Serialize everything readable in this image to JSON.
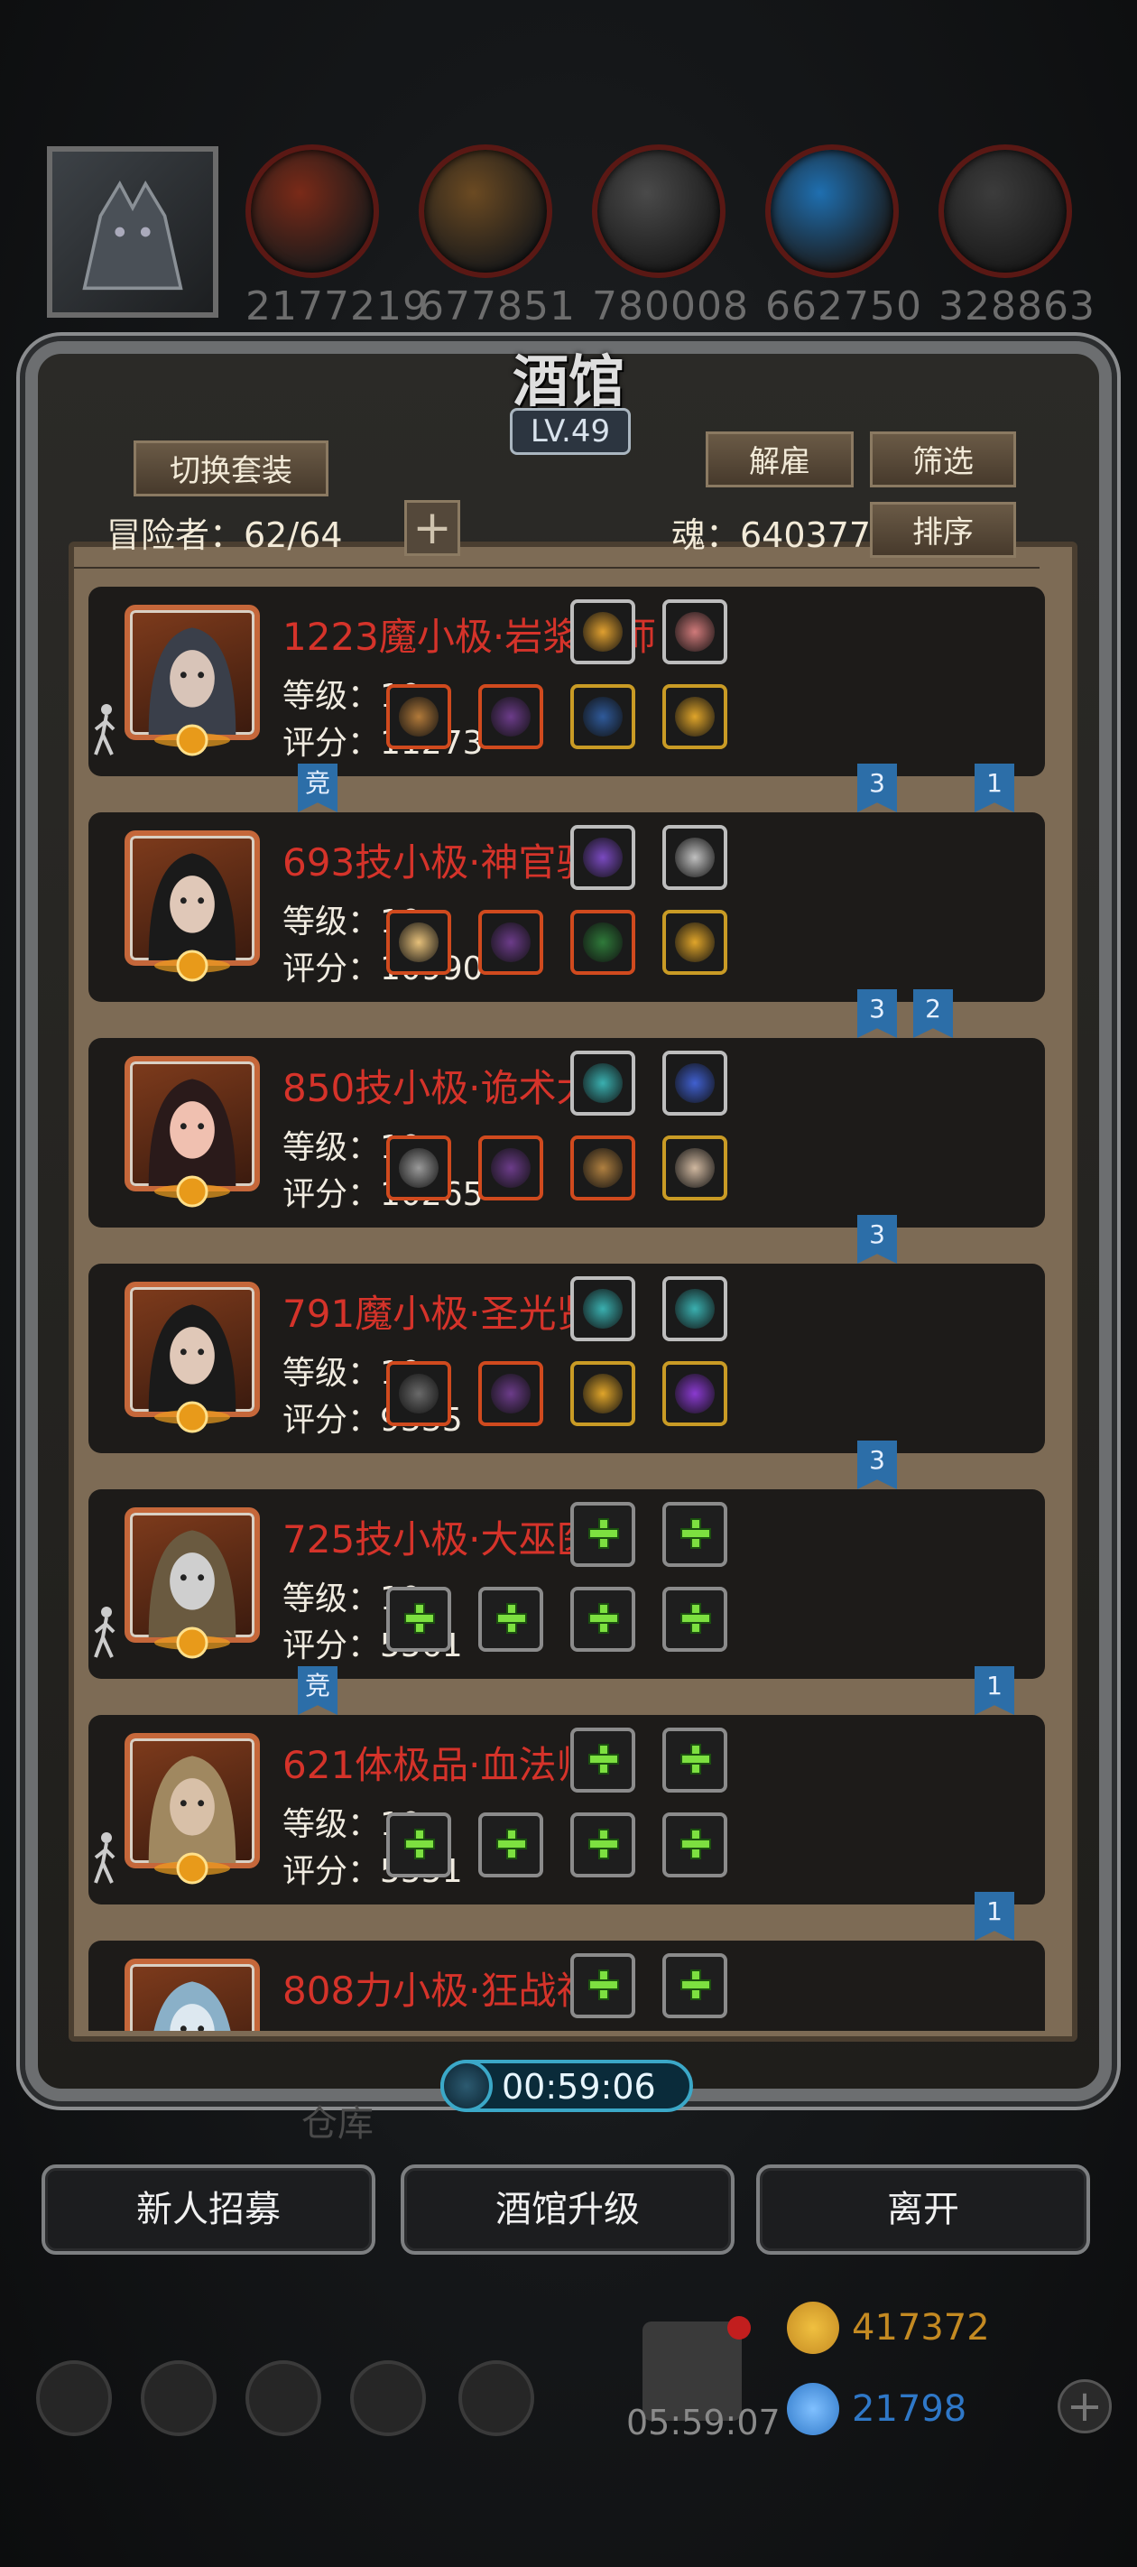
{
  "resources": [
    {
      "icon": "meat-icon",
      "value": "2177219",
      "color": "#7a2a18"
    },
    {
      "icon": "wood-icon",
      "value": "677851",
      "color": "#6b4a22"
    },
    {
      "icon": "iron-icon",
      "value": "780008",
      "color": "#4a4a4a"
    },
    {
      "icon": "crystal-icon",
      "value": "662750",
      "color": "#1f6fb0"
    },
    {
      "icon": "stone-icon",
      "value": "328863",
      "color": "#3c3c3c"
    }
  ],
  "panel": {
    "title": "酒馆",
    "level": "LV.49",
    "switch_outfit": "切换套装",
    "dismiss": "解雇",
    "filter": "筛选",
    "sort": "排序",
    "adventurers": "冒险者：62/64",
    "soul": "魂：640377"
  },
  "heroes": [
    {
      "name": "1223魔小极·岩浆法师",
      "level": "等级：10",
      "score": "评分：11273",
      "portrait": "hooded-mage",
      "equip": [
        "staff",
        "armor",
        "amulet",
        "ring"
      ],
      "top": [
        "lantern",
        "meat"
      ],
      "tags": [
        {
          "t": "竞",
          "pos": "left"
        },
        {
          "t": "3",
          "pos": "r1"
        },
        {
          "t": "1",
          "pos": "r2"
        }
      ]
    },
    {
      "name": "693技小极·神官骑士",
      "level": "等级：10",
      "score": "评分：10990",
      "portrait": "nun",
      "equip": [
        "hammer",
        "armor",
        "glove",
        "ring"
      ],
      "top": [
        "potion",
        "sigil"
      ],
      "tags": [
        {
          "t": "3",
          "pos": "r1"
        },
        {
          "t": "2",
          "pos": "r1b"
        }
      ]
    },
    {
      "name": "850技小极·诡术大师",
      "level": "等级：10",
      "score": "评分：10265",
      "portrait": "witch",
      "equip": [
        "sword",
        "armor",
        "orb",
        "mask"
      ],
      "top": [
        "gem",
        "crystal"
      ],
      "tags": [
        {
          "t": "3",
          "pos": "r1"
        }
      ]
    },
    {
      "name": "791魔小极·圣光贤者",
      "level": "等级：10",
      "score": "评分：9335",
      "portrait": "nun",
      "equip": [
        "axe",
        "armor",
        "ring",
        "sparkle"
      ],
      "top": [
        "gem",
        "gem"
      ],
      "tags": [
        {
          "t": "3",
          "pos": "r1"
        }
      ]
    },
    {
      "name": "725技小极·大巫医",
      "level": "等级：10",
      "score": "评分：5561",
      "portrait": "elder",
      "equip": [],
      "top": [],
      "tags": [
        {
          "t": "竞",
          "pos": "left"
        },
        {
          "t": "1",
          "pos": "r2"
        }
      ]
    },
    {
      "name": "621体极品·血法师",
      "level": "等级：10",
      "score": "评分：5551",
      "portrait": "elf",
      "equip": [],
      "top": [],
      "tags": [
        {
          "t": "1",
          "pos": "r2"
        }
      ]
    },
    {
      "name": "808力小极·狂战神",
      "level": "",
      "score": "",
      "portrait": "beast",
      "equip": [],
      "top": [],
      "tags": []
    }
  ],
  "timer": "00:59:06",
  "faded_label": "仓库",
  "buttons": {
    "recruit": "新人招募",
    "upgrade": "酒馆升级",
    "leave": "离开"
  },
  "dock": {
    "gift_timer": "05:59:07",
    "gold": "417372",
    "gems": "21798",
    "gold_color": "#c48a22",
    "gem_color": "#2f78c8"
  }
}
